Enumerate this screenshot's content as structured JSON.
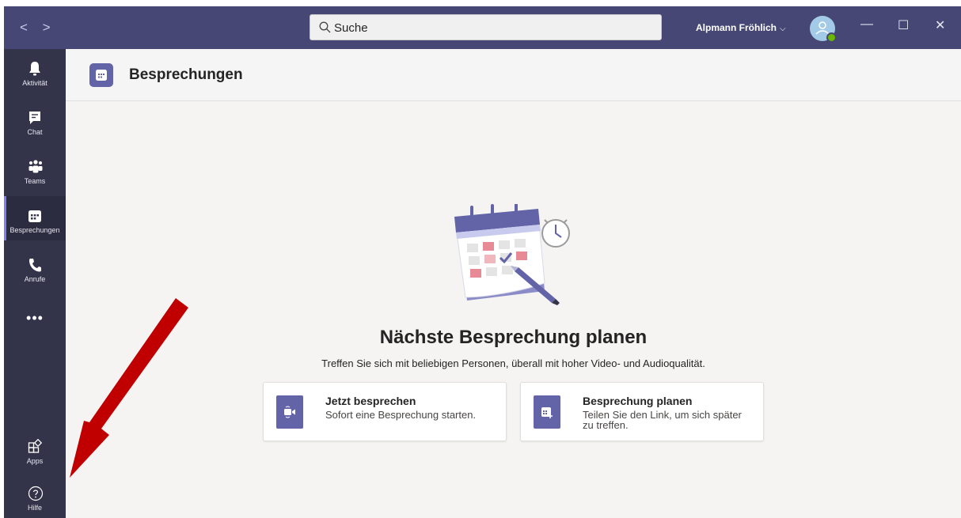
{
  "titlebar": {
    "search_placeholder": "Suche",
    "user_name": "Alpmann Fröhlich",
    "chevron": "⌵",
    "back_icon": "chevron-left-icon",
    "forward_icon": "chevron-right-icon",
    "minimize": "—",
    "maximize": "☐",
    "close": "✕"
  },
  "rail": {
    "items": [
      {
        "label": "Aktivität",
        "icon": "bell-icon"
      },
      {
        "label": "Chat",
        "icon": "chat-icon"
      },
      {
        "label": "Teams",
        "icon": "teams-icon"
      },
      {
        "label": "Besprechungen",
        "icon": "calendar-icon",
        "active": true
      },
      {
        "label": "Anrufe",
        "icon": "phone-icon"
      }
    ],
    "more": "•••",
    "apps_label": "Apps",
    "help_label": "Hilfe"
  },
  "header": {
    "title": "Besprechungen"
  },
  "main": {
    "headline": "Nächste Besprechung planen",
    "subline": "Treffen Sie sich mit beliebigen Personen, überall mit hoher Video- und Audioqualität.",
    "cards": [
      {
        "title": "Jetzt besprechen",
        "desc": "Sofort eine Besprechung starten.",
        "icon": "video-camera-icon"
      },
      {
        "title": "Besprechung planen",
        "desc": "Teilen Sie den Link, um sich später zu treffen.",
        "icon": "calendar-add-icon"
      }
    ]
  },
  "colors": {
    "titlebar": "#464775",
    "rail": "#33344a",
    "accent": "#6264a7",
    "annotation_arrow": "#c00000"
  }
}
